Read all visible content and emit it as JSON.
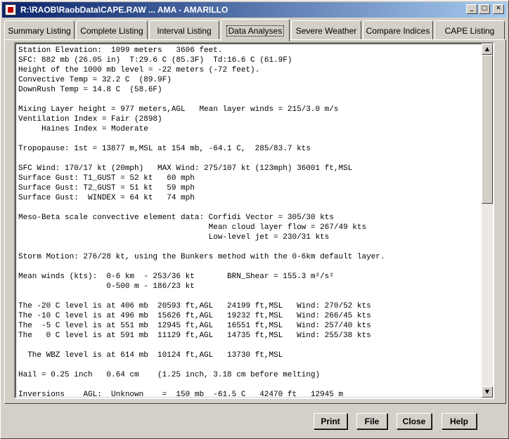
{
  "window": {
    "title": "R:\\RAOB\\RaobData\\CAPE.RAW ... AMA - AMARILLO",
    "minimize": "_",
    "maximize": "□",
    "close": "✕"
  },
  "tabs": [
    {
      "label": "Summary Listing"
    },
    {
      "label": "Complete Listing"
    },
    {
      "label": "Interval Listing"
    },
    {
      "label": "Data Analyses",
      "active": true
    },
    {
      "label": "Severe Weather"
    },
    {
      "label": "Compare Indices"
    },
    {
      "label": "CAPE Listing"
    }
  ],
  "report_lines": [
    "Station Elevation:  1099 meters   3606 feet.",
    "SFC: 882 mb (26.05 in)  T:29.6 C (85.3F)  Td:16.6 C (61.9F)",
    "Height of the 1000 mb level = -22 meters (-72 feet).",
    "Convective Temp = 32.2 C  (89.9F)",
    "DownRush Temp = 14.8 C  (58.6F)",
    "",
    "Mixing Layer height = 977 meters,AGL   Mean layer winds = 215/3.0 m/s",
    "Ventilation Index = Fair (2898)",
    "     Haines Index = Moderate",
    "",
    "Tropopause: 1st = 13877 m,MSL at 154 mb, -64.1 C,  285/83.7 kts",
    "",
    "SFC Wind: 170/17 kt (20mph)   MAX Wind: 275/107 kt (123mph) 36001 ft,MSL",
    "Surface Gust: T1_GUST = 52 kt   60 mph",
    "Surface Gust: T2_GUST = 51 kt   59 mph",
    "Surface Gust:  WINDEX = 64 kt   74 mph",
    "",
    "Meso-Beta scale convective element data: Corfidi Vector = 305/30 kts",
    "                                         Mean cloud layer flow = 267/49 kts",
    "                                         Low-level jet = 230/31 kts",
    "",
    "Storm Motion: 276/28 kt, using the Bunkers method with the 0-6km default layer.",
    "",
    "Mean winds (kts):  0-6 km  - 253/36 kt       BRN_Shear = 155.3 m²/s²",
    "                   0-500 m - 186/23 kt",
    "",
    "The -20 C level is at 406 mb  20593 ft,AGL   24199 ft,MSL   Wind: 270/52 kts",
    "The -10 C level is at 496 mb  15626 ft,AGL   19232 ft,MSL   Wind: 266/45 kts",
    "The  -5 C level is at 551 mb  12945 ft,AGL   16551 ft,MSL   Wind: 257/40 kts",
    "The   0 C level is at 591 mb  11129 ft,AGL   14735 ft,MSL   Wind: 255/38 kts",
    "",
    "  The WBZ level is at 614 mb  10124 ft,AGL   13730 ft,MSL",
    "",
    "Hail = 0.25 inch   0.64 cm    (1.25 inch, 3.18 cm before melting)",
    "",
    "Inversions    AGL:  Unknown    =  150 mb  -61.5 C   42470 ft   12945 m"
  ],
  "scrollbar": {
    "up": "▲",
    "down": "▼"
  },
  "buttons": {
    "print": "Print",
    "file": "File",
    "close": "Close",
    "help": "Help"
  }
}
